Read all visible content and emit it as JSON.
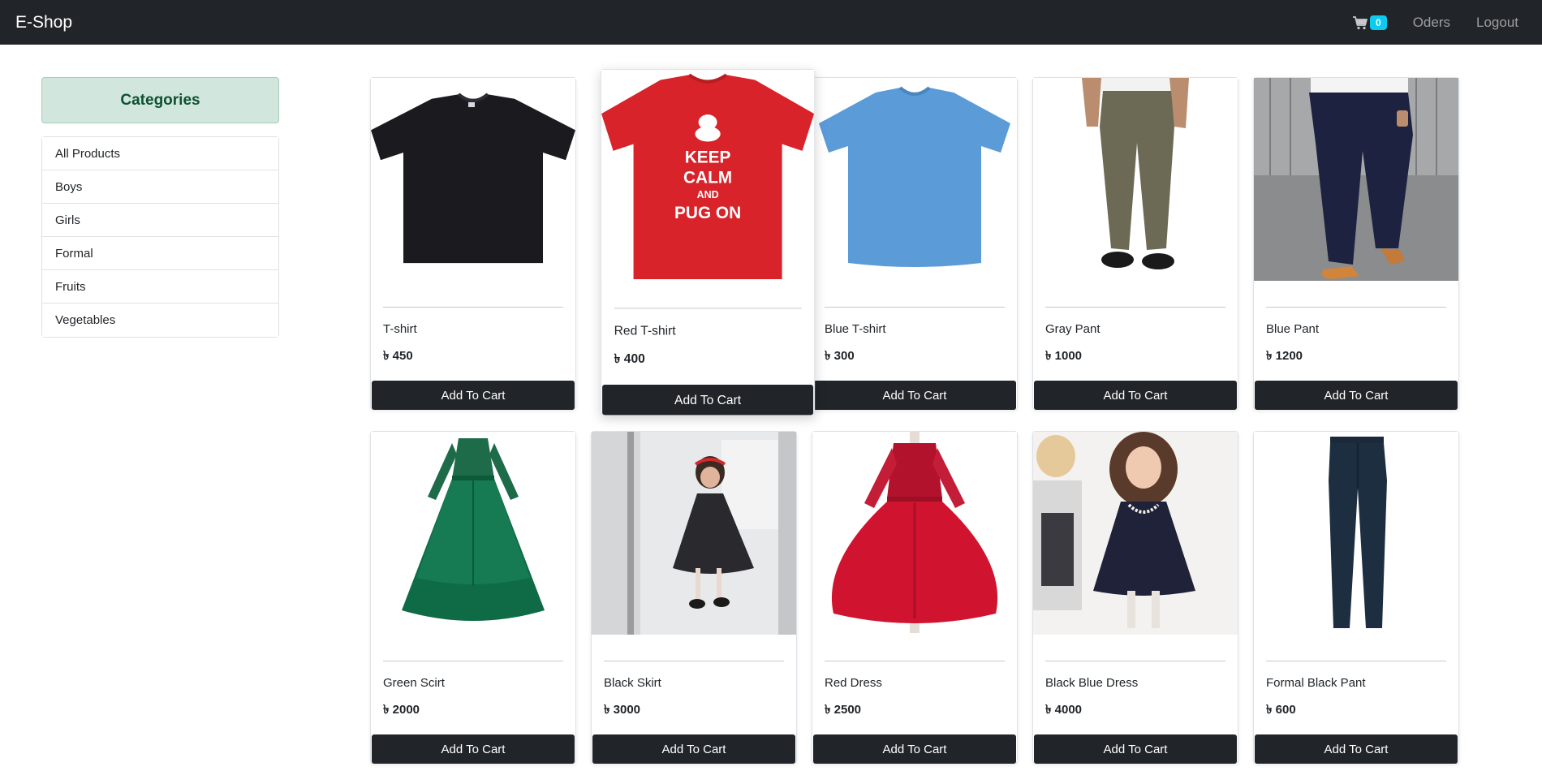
{
  "navbar": {
    "brand": "E-Shop",
    "cart_count": "0",
    "orders_label": "Oders",
    "logout_label": "Logout"
  },
  "sidebar": {
    "title": "Categories",
    "items": [
      {
        "label": "All Products"
      },
      {
        "label": "Boys"
      },
      {
        "label": "Girls"
      },
      {
        "label": "Formal"
      },
      {
        "label": "Fruits"
      },
      {
        "label": "Vegetables"
      }
    ]
  },
  "currency_symbol": "৳",
  "products": [
    {
      "name": "T-shirt",
      "price": "450",
      "image": "black-tshirt",
      "button": "Add To Cart"
    },
    {
      "name": "Red T-shirt",
      "price": "400",
      "image": "red-tshirt-keep-calm",
      "image_text": [
        "KEEP",
        "CALM",
        "AND",
        "PUG ON"
      ],
      "button": "Add To Cart"
    },
    {
      "name": "Blue T-shirt",
      "price": "300",
      "image": "blue-tshirt",
      "button": "Add To Cart"
    },
    {
      "name": "Gray Pant",
      "price": "1000",
      "image": "gray-pant",
      "button": "Add To Cart"
    },
    {
      "name": "Blue Pant",
      "price": "1200",
      "image": "blue-pant",
      "button": "Add To Cart"
    },
    {
      "name": "Green Scirt",
      "price": "2000",
      "image": "green-gown",
      "button": "Add To Cart"
    },
    {
      "name": "Black Skirt",
      "price": "3000",
      "image": "black-dress-girl",
      "button": "Add To Cart"
    },
    {
      "name": "Red Dress",
      "price": "2500",
      "image": "red-dress",
      "button": "Add To Cart"
    },
    {
      "name": "Black Blue Dress",
      "price": "4000",
      "image": "navy-dress-girl",
      "button": "Add To Cart"
    },
    {
      "name": "Formal Black Pant",
      "price": "600",
      "image": "formal-black-pant",
      "button": "Add To Cart"
    }
  ],
  "colors": {
    "navbar_bg": "#212529",
    "badge_bg": "#0dcaf0",
    "category_header_bg": "#d1e7dd",
    "button_bg": "#212529"
  }
}
